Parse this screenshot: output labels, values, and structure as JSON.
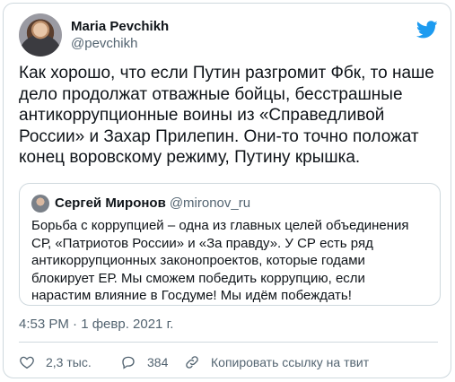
{
  "author": {
    "display_name": "Maria Pevchikh",
    "handle": "@pevchikh"
  },
  "tweet_text": "Как хорошо, что если Путин разгромит Фбк, то наше дело продолжат отважные бойцы, бесстрашные антикоррупционные воины из «Справедливой России» и Захар Прилепин. Они-то точно положат конец воровскому режиму, Путину крышка.",
  "quoted": {
    "display_name": "Сергей Миронов",
    "handle": "@mironov_ru",
    "text": "Борьба с коррупцией – одна из главных целей объединения СР, «Патриотов России» и «За правду». У СР есть ряд антикоррупционных законопроектов, которые годами блокирует ЕР. Мы сможем победить коррупцию, если нарастим влияние в Госдуме! Мы идём побеждать!"
  },
  "timestamp": "4:53 PM · 1 февр. 2021 г.",
  "actions": {
    "likes": "2,3 тыс.",
    "replies": "384",
    "copy_link": "Копировать ссылку на твит"
  },
  "icons": {
    "brand": "twitter-bird-icon",
    "like": "heart-icon",
    "reply": "reply-bubble-icon",
    "copy": "link-icon"
  },
  "colors": {
    "twitter_blue": "#1d9bf0",
    "text_primary": "#0f1419",
    "text_secondary": "#536471",
    "border": "#cfd9de"
  }
}
